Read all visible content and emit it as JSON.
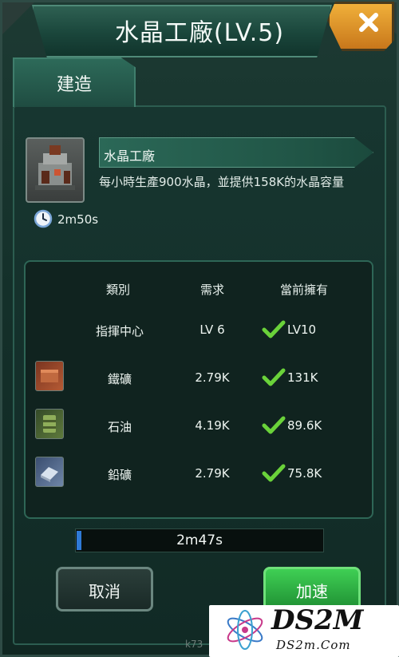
{
  "window": {
    "title": "水晶工廠(LV.5)"
  },
  "tabs": [
    {
      "label": "建造"
    }
  ],
  "building": {
    "name": "水晶工廠",
    "description": "每小時生產900水晶，並提供158K的水晶容量",
    "build_time": "2m50s"
  },
  "requirements": {
    "headers": {
      "category": "類別",
      "required": "需求",
      "owned": "當前擁有"
    },
    "rows": [
      {
        "category": "指揮中心",
        "required": "LV 6",
        "owned": "LV10",
        "icon": null
      },
      {
        "category": "鐵礦",
        "required": "2.79K",
        "owned": "131K",
        "icon": "iron-ore-icon"
      },
      {
        "category": "石油",
        "required": "4.19K",
        "owned": "89.6K",
        "icon": "oil-barrel-icon"
      },
      {
        "category": "鉛礦",
        "required": "2.79K",
        "owned": "75.8K",
        "icon": "lead-ore-icon"
      }
    ]
  },
  "progress": {
    "remaining": "2m47s",
    "fill_fraction": 0.02
  },
  "buttons": {
    "cancel": "取消",
    "speedup": "加速"
  },
  "watermark": {
    "brand": "DS2M",
    "domain": "DS2m.Com",
    "site_partial": "k73"
  },
  "colors": {
    "accent_green": "#1f8f33",
    "check_green": "#6ad23a",
    "progress_blue": "#2f7ad6",
    "close_orange": "#e89a2c"
  }
}
